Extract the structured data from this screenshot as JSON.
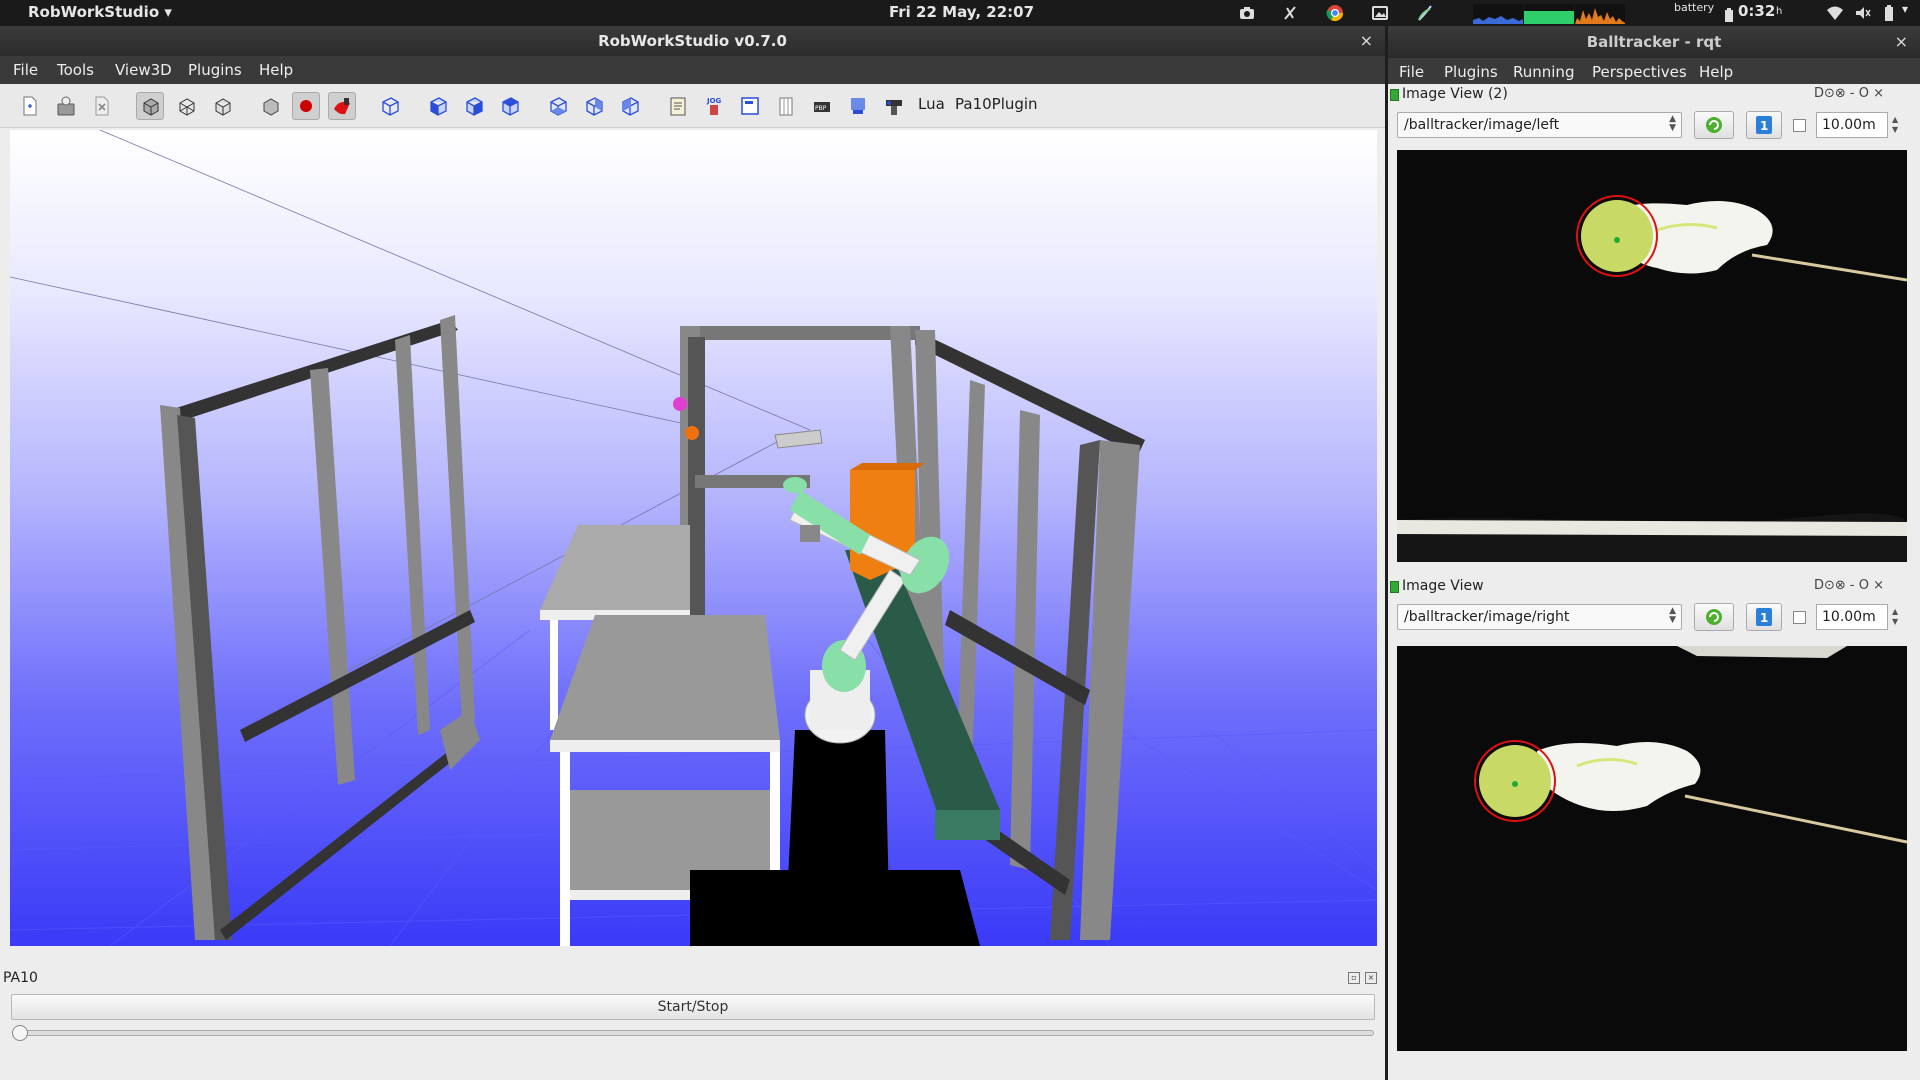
{
  "topbar": {
    "app_menu": "RobWorkStudio ▾",
    "clock": "Fri 22 May, 22:07",
    "battery_label": "battery",
    "battery_time": "0:32",
    "battery_unit": "h",
    "icons": [
      "camera-icon",
      "mute-icon",
      "chrome-icon",
      "screenshot-icon",
      "network-activity-icon",
      "cpu-graph",
      "memory-graph",
      "load-graph",
      "wifi-icon",
      "volume-icon",
      "battery-icon"
    ]
  },
  "rws": {
    "title": "RobWorkStudio v0.7.0",
    "close": "×",
    "menu": [
      "File",
      "Tools",
      "View3D",
      "Plugins",
      "Help"
    ],
    "toolbar_text": {
      "lua": "Lua",
      "plugin": "Pa10Plugin"
    },
    "toolbar_icons": [
      "new-icon",
      "open-icon",
      "close-file-icon",
      "solid-view-icon",
      "wireframe-view-icon",
      "outline-view-icon",
      "cube-icon",
      "record-icon",
      "palette-icon",
      "perspective-icon",
      "front-view-icon",
      "right-view-icon",
      "top-view-icon",
      "back-view-icon",
      "left-view-icon",
      "bottom-view-icon",
      "log-icon",
      "jog-icon",
      "treeview-icon",
      "propertyview-icon",
      "playback-icon",
      "planning-icon",
      "sensors-icon"
    ],
    "pa10": {
      "title": "PA10",
      "start_stop": "Start/Stop",
      "slider_value": 0
    }
  },
  "rqt": {
    "title": "Balltracker - rqt",
    "close": "×",
    "menu": [
      "File",
      "Plugins",
      "Running",
      "Perspectives",
      "Help"
    ],
    "panels": [
      {
        "title": "Image View (2)",
        "topic": "/balltracker/image/left",
        "timeout": "10.00m",
        "checked": false,
        "controls": "D⊙⊗  - O ×"
      },
      {
        "title": "Image View",
        "topic": "/balltracker/image/right",
        "timeout": "10.00m",
        "checked": false,
        "controls": "D⊙⊗  - O ×"
      }
    ]
  },
  "colors": {
    "desktop_bar": "#1a1a1a",
    "window_chrome": "#2c2c2c",
    "sky_top": "#ffffff",
    "sky_bottom": "#3a3af8",
    "robot_joint": "#88e0a8",
    "box_orange": "#f07f12",
    "conveyor": "#2a5a48",
    "tracking_circle": "#dd1111",
    "ball": "#d6e77a"
  }
}
